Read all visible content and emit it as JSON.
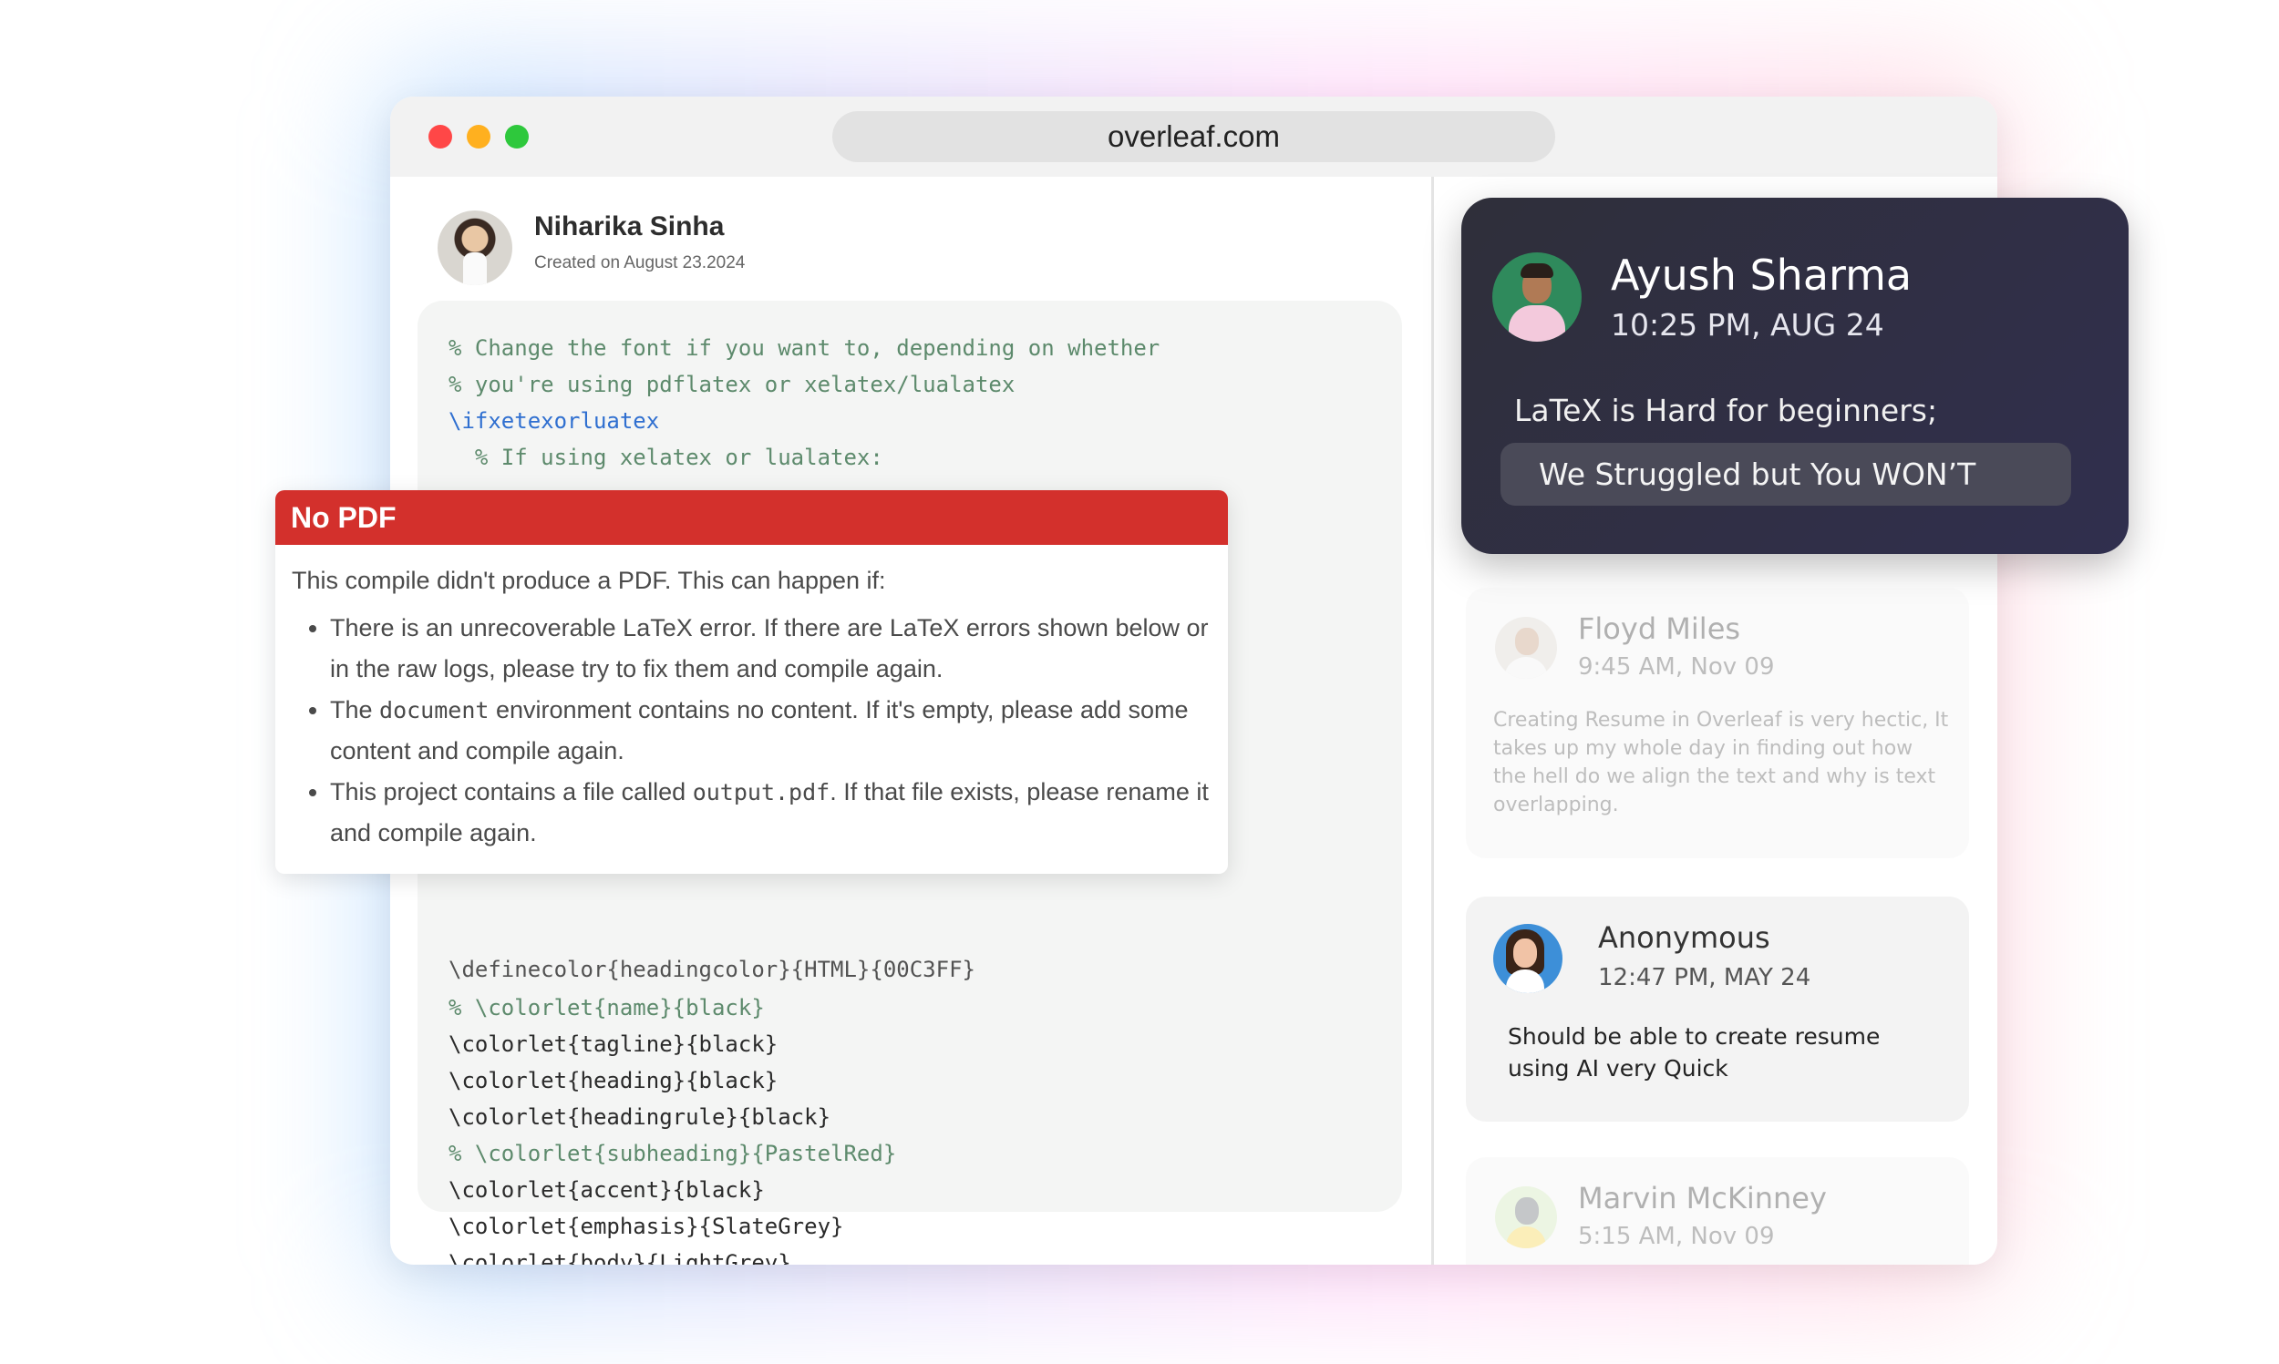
{
  "browser": {
    "url": "overleaf.com"
  },
  "author": {
    "name": "Niharika Sinha",
    "created": "Created on August 23.2024"
  },
  "code": {
    "lines_top": [
      "% Change the font if you want to, depending on whether",
      "% you're using pdflatex or xelatex/lualatex",
      "\\ifxetexorluatex",
      "  % If using xelatex or lualatex:"
    ],
    "partial_line": "\\definecolor{headingcolor}{HTML}{00C3FF}",
    "lines_bottom": [
      "% \\colorlet{name}{black}",
      "\\colorlet{tagline}{black}",
      "\\colorlet{heading}{black}",
      "\\colorlet{headingrule}{black}",
      "% \\colorlet{subheading}{PastelRed}",
      "\\colorlet{accent}{black}",
      "\\colorlet{emphasis}{SlateGrey}",
      "\\colorlet{body}{LightGrey}"
    ]
  },
  "error_panel": {
    "title": "No PDF",
    "intro": "This compile didn't produce a PDF. This can happen if:",
    "bullet1": "There is an unrecoverable LaTeX error. If there are LaTeX errors shown below or in the raw logs, please try to fix them and compile again.",
    "bullet2_pre": "The ",
    "bullet2_code": "document",
    "bullet2_post": " environment contains no content. If it's empty, please add some content and compile again.",
    "bullet3_pre": "This project contains a file called ",
    "bullet3_code": "output.pdf",
    "bullet3_post": ". If that file exists, please rename it and compile again."
  },
  "featured_comment": {
    "name": "Ayush Sharma",
    "time": "10:25 PM, AUG 24",
    "line1": "LaTeX is Hard for beginners;",
    "line2": "We Struggled but You WON’T"
  },
  "comments": [
    {
      "name": "Floyd Miles",
      "time": "9:45 AM, Nov 09",
      "text": "Creating Resume in Overleaf is very hectic, It takes up my whole day in finding out how the hell do we align the text and why is text overlapping."
    },
    {
      "name": "Anonymous",
      "time": "12:47 PM, MAY 24",
      "text": "Should be able to create resume using AI very Quick"
    },
    {
      "name": "Marvin McKinney",
      "time": "5:15 AM, Nov 09"
    }
  ]
}
